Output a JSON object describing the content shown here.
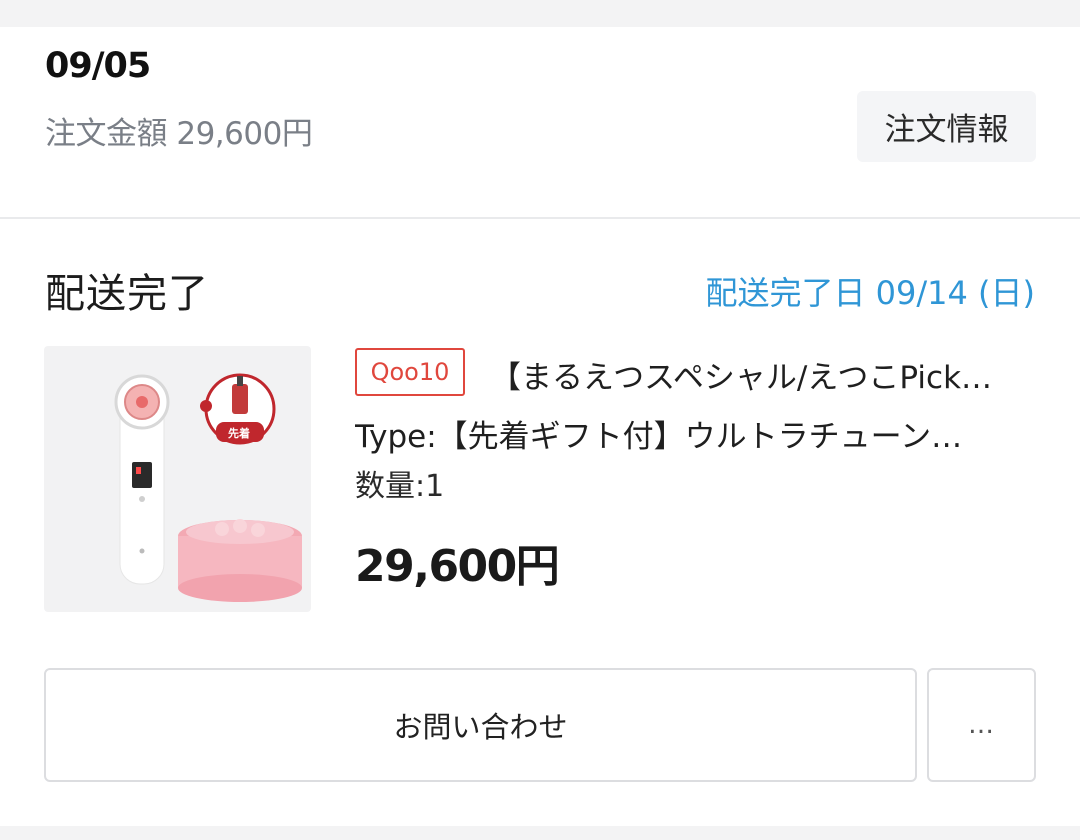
{
  "order": {
    "date": "09/05",
    "total_label": "注文金額 29,600円",
    "info_button": "注文情報"
  },
  "delivery": {
    "status": "配送完了",
    "completed_date": "配送完了日 09/14 (日)"
  },
  "product": {
    "shop_badge": "Qoo10",
    "title": "【まるえつスペシャル/えつこPick…",
    "type": "Type:【先着ギフト付】ウルトラチューン…",
    "quantity": "数量:1",
    "price": "29,600円",
    "gift_tag": "先着",
    "image_icon": "beauty-device-with-cream-image"
  },
  "actions": {
    "contact_label": "お問い合わせ",
    "more_label": "…"
  },
  "colors": {
    "accent_blue": "#2f96d6",
    "badge_red": "#e0473d",
    "muted_text": "#7a7f87"
  }
}
